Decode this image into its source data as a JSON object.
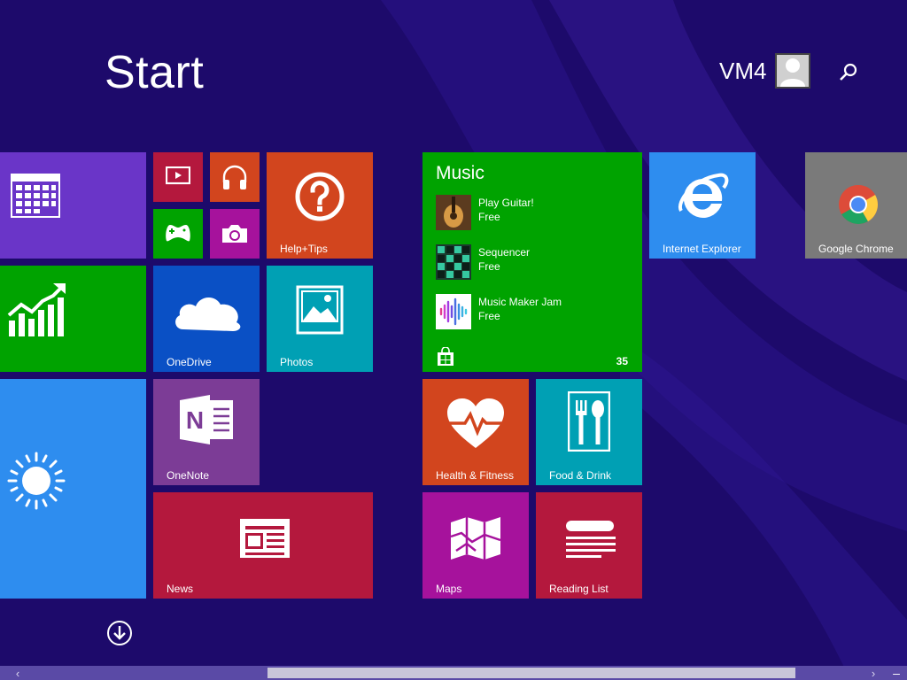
{
  "header": {
    "title": "Start",
    "user_name": "VM4",
    "avatar_icon": "user-icon",
    "search_icon": "search-icon"
  },
  "colors": {
    "background": "#1d0a6b",
    "calendar": "#6a35c8",
    "finance": "#00a300",
    "weather": "#2e8def",
    "video": "#b4183d",
    "music_small": "#d2451e",
    "games": "#00a300",
    "camera": "#a6129c",
    "help": "#d2451e",
    "onedrive": "#0a50c5",
    "photos": "#00a0b4",
    "onenote": "#7c3c96",
    "news": "#b4183d",
    "music_tile": "#00a300",
    "ie": "#2e8def",
    "chrome": "#7a7a7a",
    "health": "#d2451e",
    "food": "#00a0b4",
    "maps": "#a6129c",
    "reading": "#b4183d"
  },
  "tiles": {
    "calendar": {
      "label": "",
      "icon": "calendar-icon"
    },
    "finance": {
      "label": "",
      "icon": "chart-icon"
    },
    "weather": {
      "label": "",
      "icon": "sun-icon"
    },
    "video": {
      "label": "",
      "icon": "video-icon"
    },
    "music_small": {
      "label": "",
      "icon": "headphones-icon"
    },
    "games": {
      "label": "",
      "icon": "gamepad-icon"
    },
    "camera": {
      "label": "",
      "icon": "camera-icon"
    },
    "help": {
      "label": "Help+Tips",
      "icon": "question-icon"
    },
    "onedrive": {
      "label": "OneDrive",
      "icon": "cloud-icon"
    },
    "photos": {
      "label": "Photos",
      "icon": "photo-icon"
    },
    "onenote": {
      "label": "OneNote",
      "icon": "onenote-icon"
    },
    "news": {
      "label": "News",
      "icon": "newspaper-icon"
    },
    "ie": {
      "label": "Internet Explorer",
      "icon": "internet-explorer-icon"
    },
    "chrome": {
      "label": "Google Chrome",
      "icon": "chrome-icon"
    },
    "health": {
      "label": "Health & Fitness",
      "icon": "heart-icon"
    },
    "food": {
      "label": "Food & Drink",
      "icon": "fork-spoon-icon"
    },
    "maps": {
      "label": "Maps",
      "icon": "map-icon"
    },
    "reading": {
      "label": "Reading List",
      "icon": "reading-list-icon"
    }
  },
  "music": {
    "title": "Music",
    "items": [
      {
        "name": "Play Guitar!",
        "price": "Free",
        "icon": "guitar-icon"
      },
      {
        "name": "Sequencer",
        "price": "Free",
        "icon": "sequencer-icon"
      },
      {
        "name": "Music Maker Jam",
        "price": "Free",
        "icon": "waveform-icon"
      }
    ],
    "count": "35",
    "store_icon": "store-icon"
  },
  "footer": {
    "down_icon": "arrow-down-icon",
    "scroll_left": "‹",
    "scroll_right": "›",
    "scroll_minus": "–"
  }
}
